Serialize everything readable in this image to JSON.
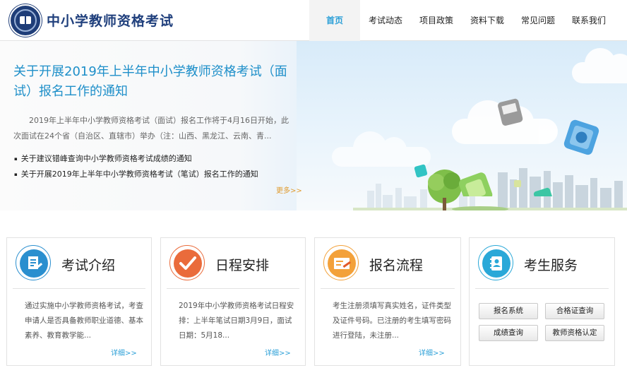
{
  "header": {
    "site_title": "中小学教师资格考试"
  },
  "nav": [
    {
      "label": "首页",
      "active": true
    },
    {
      "label": "考试动态",
      "active": false
    },
    {
      "label": "项目政策",
      "active": false
    },
    {
      "label": "资料下载",
      "active": false
    },
    {
      "label": "常见问题",
      "active": false
    },
    {
      "label": "联系我们",
      "active": false
    }
  ],
  "hero": {
    "title": "关于开展2019年上半年中小学教师资格考试（面试）报名工作的通知",
    "summary": "2019年上半年中小学教师资格考试（面试）报名工作将于4月16日开始，此次面试在24个省（自治区、直辖市）举办（注：山西、黑龙江、云南、青...",
    "links": [
      "关于建议错峰查询中小学教师资格考试成绩的通知",
      "关于开展2019年上半年中小学教师资格考试（笔试）报名工作的通知"
    ],
    "more": "更多>>"
  },
  "cards": [
    {
      "title": "考试介绍",
      "text": "通过实施中小学教师资格考试，考查申请人是否具备教师职业道德、基本素养、教育教学能...",
      "more": "详细>>",
      "icon": "document-edit-icon",
      "color": "#2a8fcf"
    },
    {
      "title": "日程安排",
      "text": "2019年中小学教师资格考试日程安排：上半年笔试日期3月9日，面试日期：5月18...",
      "more": "详细>>",
      "icon": "checkmark-icon",
      "color": "#ea6b3b"
    },
    {
      "title": "报名流程",
      "text": "考生注册须填写真实姓名，证件类型及证件号码。已注册的考生填写密码进行登陆，未注册...",
      "more": "详细>>",
      "icon": "form-pen-icon",
      "color": "#f3a13a"
    },
    {
      "title": "考生服务",
      "icon": "contact-book-icon",
      "color": "#29a8d8",
      "buttons": [
        "报名系统",
        "合格证查询",
        "成绩查询",
        "教师资格认定"
      ]
    }
  ]
}
